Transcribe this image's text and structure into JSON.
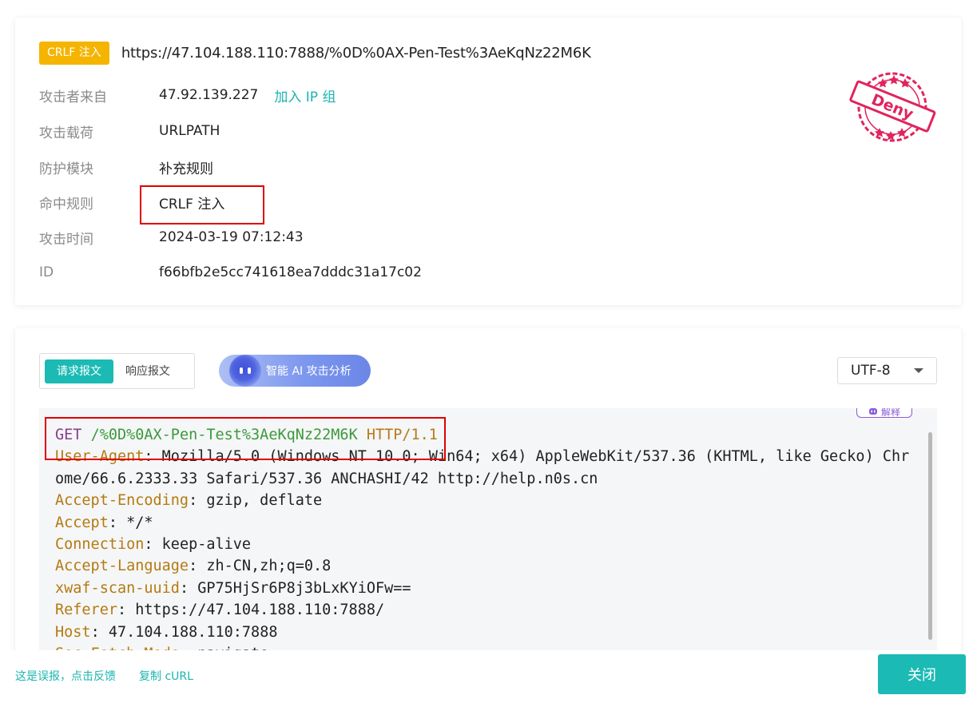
{
  "event": {
    "tag": "CRLF 注入",
    "url": "https://47.104.188.110:7888/%0D%0AX-Pen-Test%3AeKqNz22M6K",
    "stamp_text": "Deny",
    "fields": [
      {
        "label": "攻击者来自",
        "value": "47.92.139.227",
        "link": "加入 IP 组"
      },
      {
        "label": "攻击载荷",
        "value": "URLPATH"
      },
      {
        "label": "防护模块",
        "value": "补充规则"
      },
      {
        "label": "命中规则",
        "value": "CRLF 注入"
      },
      {
        "label": "攻击时间",
        "value": "2024-03-19 07:12:43"
      },
      {
        "label": "ID",
        "value": "f66bfb2e5cc741618ea7dddc31a17c02"
      }
    ]
  },
  "packet": {
    "tabs": [
      "请求报文",
      "响应报文"
    ],
    "active_tab": "请求报文",
    "ai_button": "智能 AI 攻击分析",
    "encoding": "UTF-8",
    "explain_label": "解释",
    "request_line": {
      "method": "GET",
      "path": "/%0D%0AX-Pen-Test%3AeKqNz22M6K",
      "protocol": "HTTP/1.1"
    },
    "headers": [
      {
        "key": "User-Agent",
        "value": "Mozilla/5.0 (Windows NT 10.0; Win64; x64) AppleWebKit/537.36 (KHTML, like Gecko) Chrome/66.6.2333.33 Safari/537.36 ANCHASHI/42 http://help.n0s.cn"
      },
      {
        "key": "Accept-Encoding",
        "value": "gzip, deflate"
      },
      {
        "key": "Accept",
        "value": "*/*"
      },
      {
        "key": "Connection",
        "value": "keep-alive"
      },
      {
        "key": "Accept-Language",
        "value": "zh-CN,zh;q=0.8"
      },
      {
        "key": "xwaf-scan-uuid",
        "value": "GP75HjSr6P8j3bLxKYiOFw=="
      },
      {
        "key": "Referer",
        "value": "https://47.104.188.110:7888/"
      },
      {
        "key": "Host",
        "value": "47.104.188.110:7888"
      },
      {
        "key": "Sec-Fetch-Mode",
        "value": "navigate"
      }
    ]
  },
  "footer": {
    "report_false_positive": "这是误报，点击反馈",
    "copy_curl": "复制 cURL",
    "close": "关闭"
  },
  "colors": {
    "accent": "#1bbab4",
    "tag": "#f5b400",
    "highlight_box": "#e00000",
    "stamp": "#e0245e"
  }
}
